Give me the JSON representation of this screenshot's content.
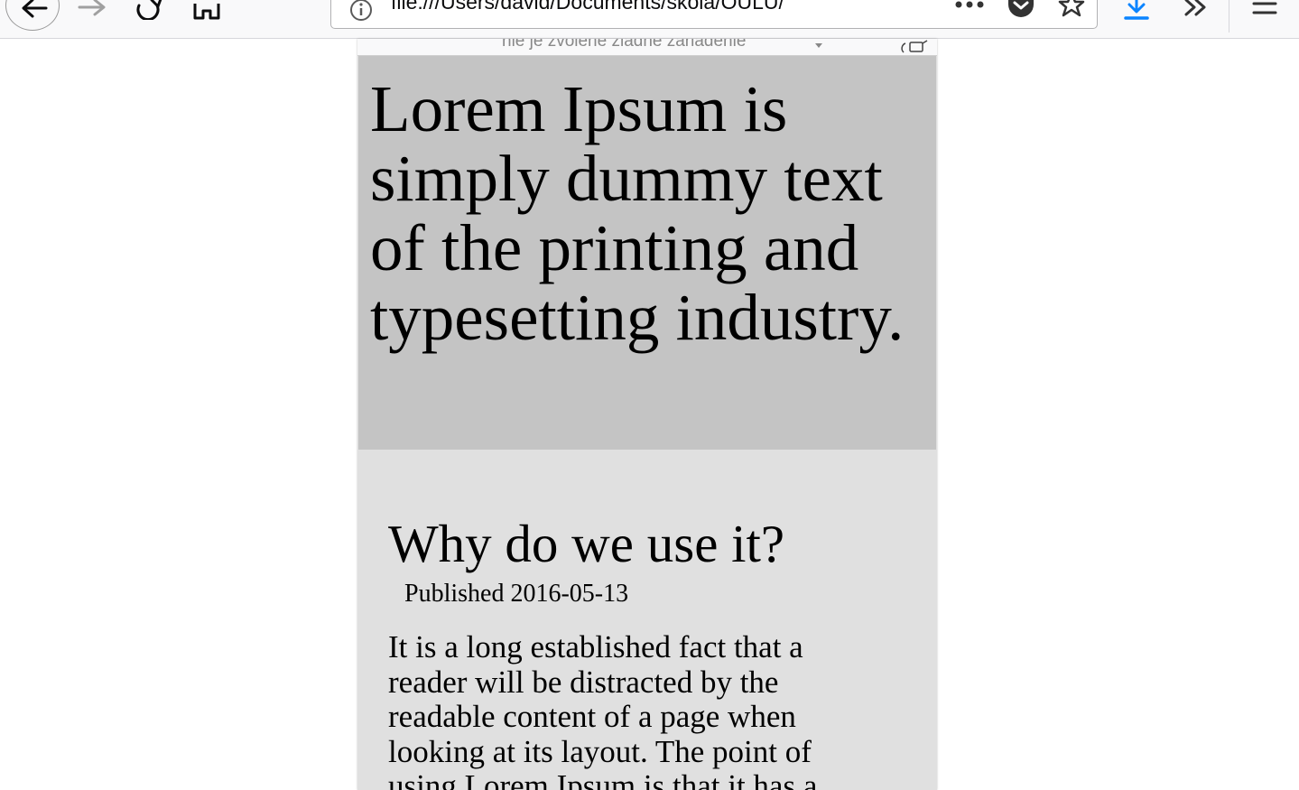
{
  "browser": {
    "url": "file:///Users/david/Documents/skola/OULU/",
    "icons": {
      "back": "back-arrow-icon",
      "forward": "forward-arrow-icon",
      "reload": "reload-icon",
      "home": "home-icon",
      "info": "info-icon",
      "page_actions": "more-dots-icon",
      "pocket": "pocket-icon",
      "bookmark": "star-icon",
      "downloads": "download-icon",
      "overflow": "chevrons-right-icon",
      "menu": "hamburger-menu-icon"
    },
    "accent_color": "#0a84ff"
  },
  "responsive_mode": {
    "device_select": "nie je zvolené žiadne zariadenie",
    "rotate_icon": "rotate-device-icon"
  },
  "page": {
    "hero_title": "Lorem Ipsum is simply dummy text of the printing and typesetting industry.",
    "hero_background": "#c4c4c4",
    "article": {
      "title": "Why do we use it?",
      "published": "Published 2016-05-13",
      "body": "It is a long established fact that a reader will be distracted by the readable content of a page when looking at its layout. The point of using Lorem Ipsum is that it has a"
    },
    "article_background": "#e0e0e0"
  }
}
